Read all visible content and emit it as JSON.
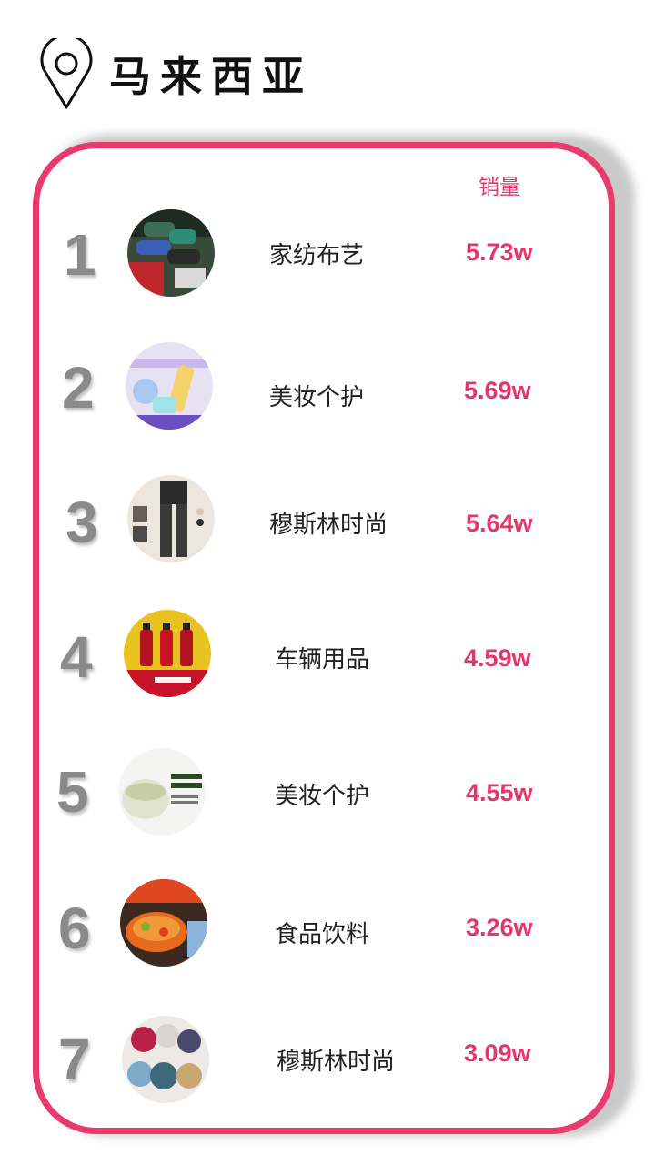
{
  "header": {
    "title": "马来西亚",
    "icon": "location-pin-icon"
  },
  "table": {
    "column_label": "销量"
  },
  "rows": [
    {
      "rank": "1",
      "category": "家纺布艺",
      "sales": "5.73w",
      "image": "home-textile-product-image"
    },
    {
      "rank": "2",
      "category": "美妆个护",
      "sales": "5.69w",
      "image": "whitening-teeth-product-image"
    },
    {
      "rank": "3",
      "category": "穆斯林时尚",
      "sales": "5.64w",
      "image": "muslim-fashion-product-image"
    },
    {
      "rank": "4",
      "category": "车辆用品",
      "sales": "4.59w",
      "image": "car-perfume-product-image"
    },
    {
      "rank": "5",
      "category": "美妆个护",
      "sales": "4.55w",
      "image": "clay-mask-product-image"
    },
    {
      "rank": "6",
      "category": "食品饮料",
      "sales": "3.26w",
      "image": "food-product-image"
    },
    {
      "rank": "7",
      "category": "穆斯林时尚",
      "sales": "3.09w",
      "image": "hijab-fashion-product-image"
    }
  ],
  "colors": {
    "accent": "#e5366a",
    "border": "#e93a6e",
    "rank": "#8a8a8a"
  }
}
